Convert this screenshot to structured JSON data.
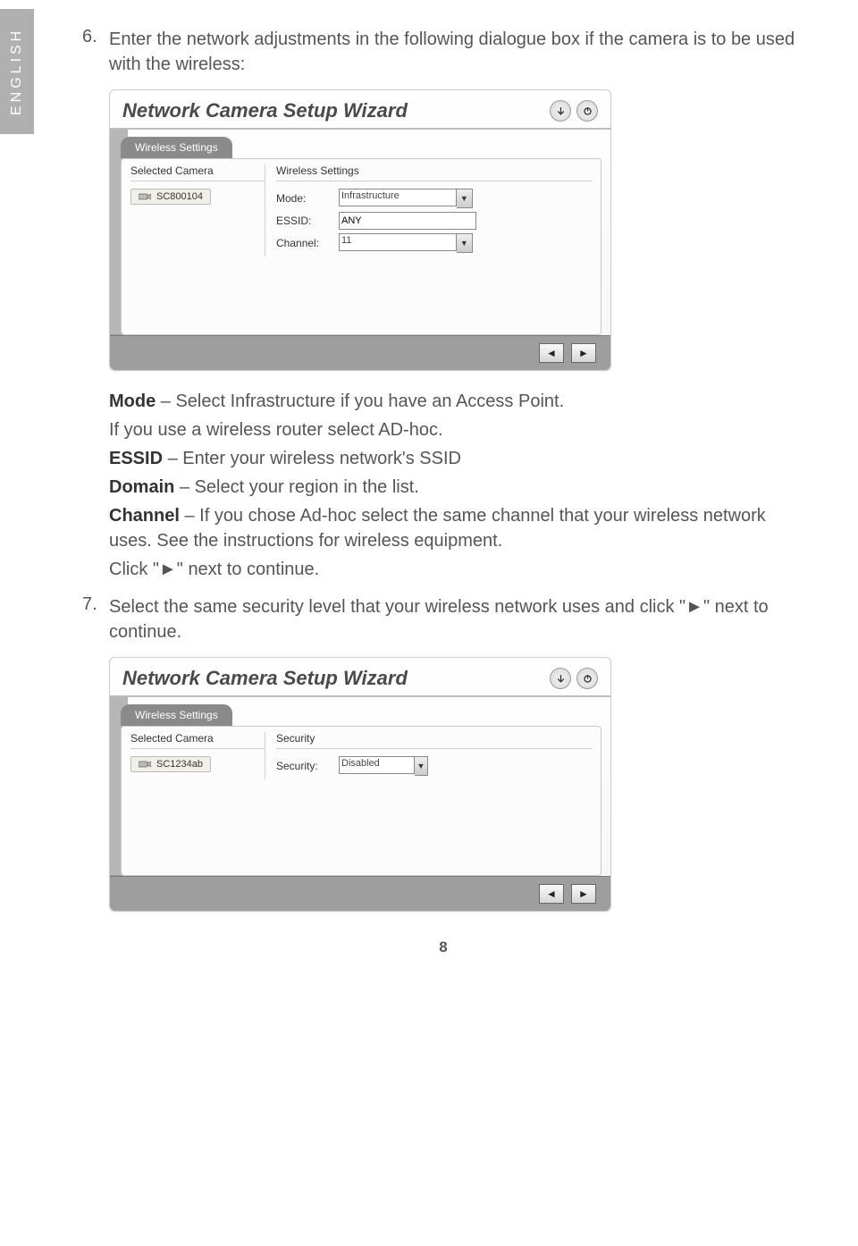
{
  "language_tab": "ENGLISH",
  "page_number": "8",
  "step6": {
    "number": "6.",
    "text": "Enter the network adjustments in the following dialogue box if the camera is to be used with the wireless:"
  },
  "wizard1": {
    "title": "Network Camera Setup Wizard",
    "tab": "Wireless Settings",
    "left_header": "Selected Camera",
    "camera": "SC800104",
    "right_header": "Wireless Settings",
    "rows": {
      "mode_label": "Mode:",
      "mode_value": "Infrastructure",
      "essid_label": "ESSID:",
      "essid_value": "ANY",
      "channel_label": "Channel:",
      "channel_value": "11"
    }
  },
  "desc": {
    "mode_b": "Mode",
    "mode_t": " – Select  Infrastructure if you have an Access Point.",
    "mode_t2": "If you use a wireless router select AD-hoc.",
    "essid_b": "ESSID",
    "essid_t": " – Enter your wireless network's SSID",
    "domain_b": "Domain",
    "domain_t": " – Select your region in the list.",
    "channel_b": "Channel",
    "channel_t": " – If you chose Ad-hoc select the same channel that your wireless network uses. See the instructions for wireless equipment.",
    "click": "Click \"►\" next to continue."
  },
  "step7": {
    "number": "7.",
    "text": "Select the same security level that your wireless network uses and click \"►\" next to continue."
  },
  "wizard2": {
    "title": "Network Camera Setup Wizard",
    "tab": "Wireless Settings",
    "left_header": "Selected Camera",
    "camera": "SC1234ab",
    "right_header": "Security",
    "rows": {
      "security_label": "Security:",
      "security_value": "Disabled"
    }
  }
}
